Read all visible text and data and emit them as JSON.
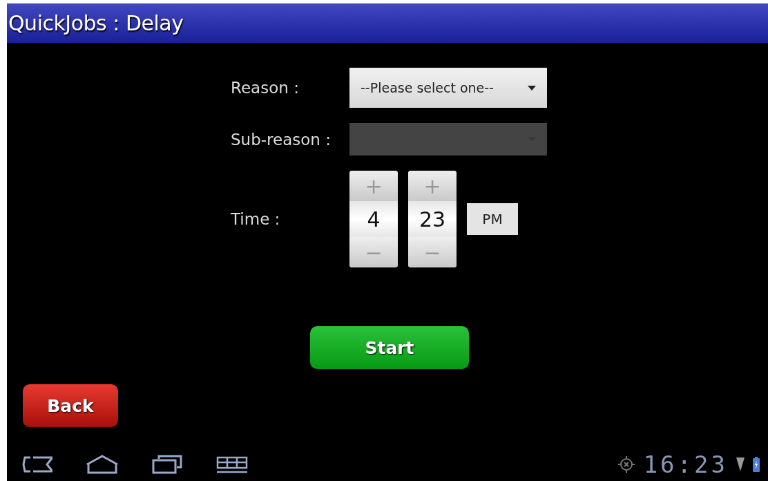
{
  "window": {
    "title": "QuickJobs : Delay"
  },
  "form": {
    "reason": {
      "label": "Reason :",
      "value": "--Please select one--",
      "disabled": false
    },
    "sub_reason": {
      "label": "Sub-reason :",
      "disabled": true
    },
    "time": {
      "label": "Time :",
      "hour": "4",
      "minute": "23",
      "plus": "+",
      "minus": "−",
      "ampm": "PM"
    }
  },
  "buttons": {
    "start": "Start",
    "back": "Back"
  },
  "status_bar": {
    "clock": "16:23"
  }
}
